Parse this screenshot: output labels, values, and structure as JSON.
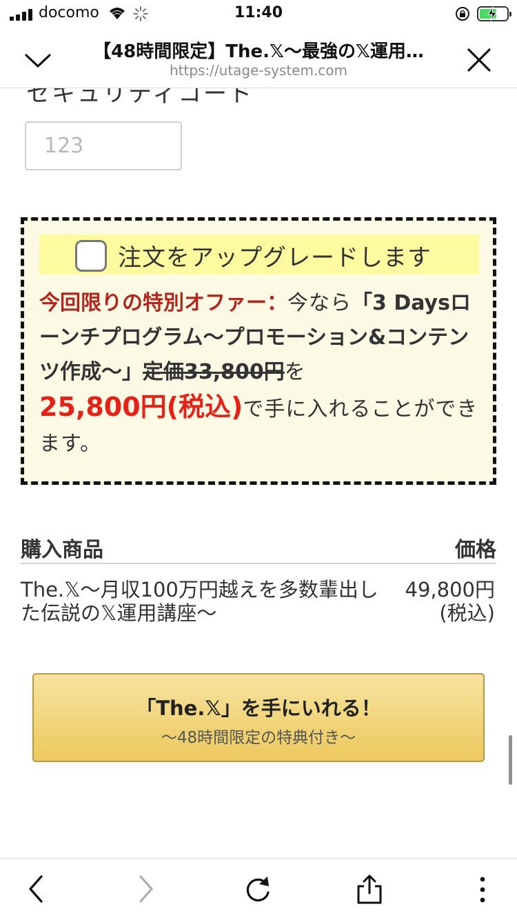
{
  "status_bar": {
    "carrier": "docomo",
    "time": "11:40"
  },
  "header": {
    "title": "【48時間限定】The.𝕏〜最強の𝕏運用…",
    "url": "https://utage-system.com"
  },
  "form": {
    "security_code_label": "セキュリティコード",
    "security_code_placeholder": "123"
  },
  "offer": {
    "checkbox_label": "注文をアップグレードします",
    "checked": false,
    "headline": "今回限りの特別オファー：",
    "text_now": "今なら",
    "product": "「3 Daysローンチプログラム〜プロモーション&コンテンツ作成〜」",
    "list_price": "定価33,800円",
    "text_wo": "を",
    "sale_price": "25,800円(税込)",
    "text_end": "で手に入れることができます。"
  },
  "products": {
    "col_item": "購入商品",
    "col_price": "価格",
    "item_name": "The.𝕏〜月収100万円越えを多数輩出した伝説の𝕏運用講座〜",
    "item_price": "49,800円(税込)"
  },
  "buy_button": {
    "main_label": "「The.𝕏」を手にいれる！",
    "sub_label": "〜48時間限定の特典付き〜",
    "color": "#ecc95e"
  },
  "toolbar": {
    "icons": [
      "back-icon",
      "forward-icon",
      "reload-icon",
      "share-icon",
      "more-icon"
    ]
  }
}
